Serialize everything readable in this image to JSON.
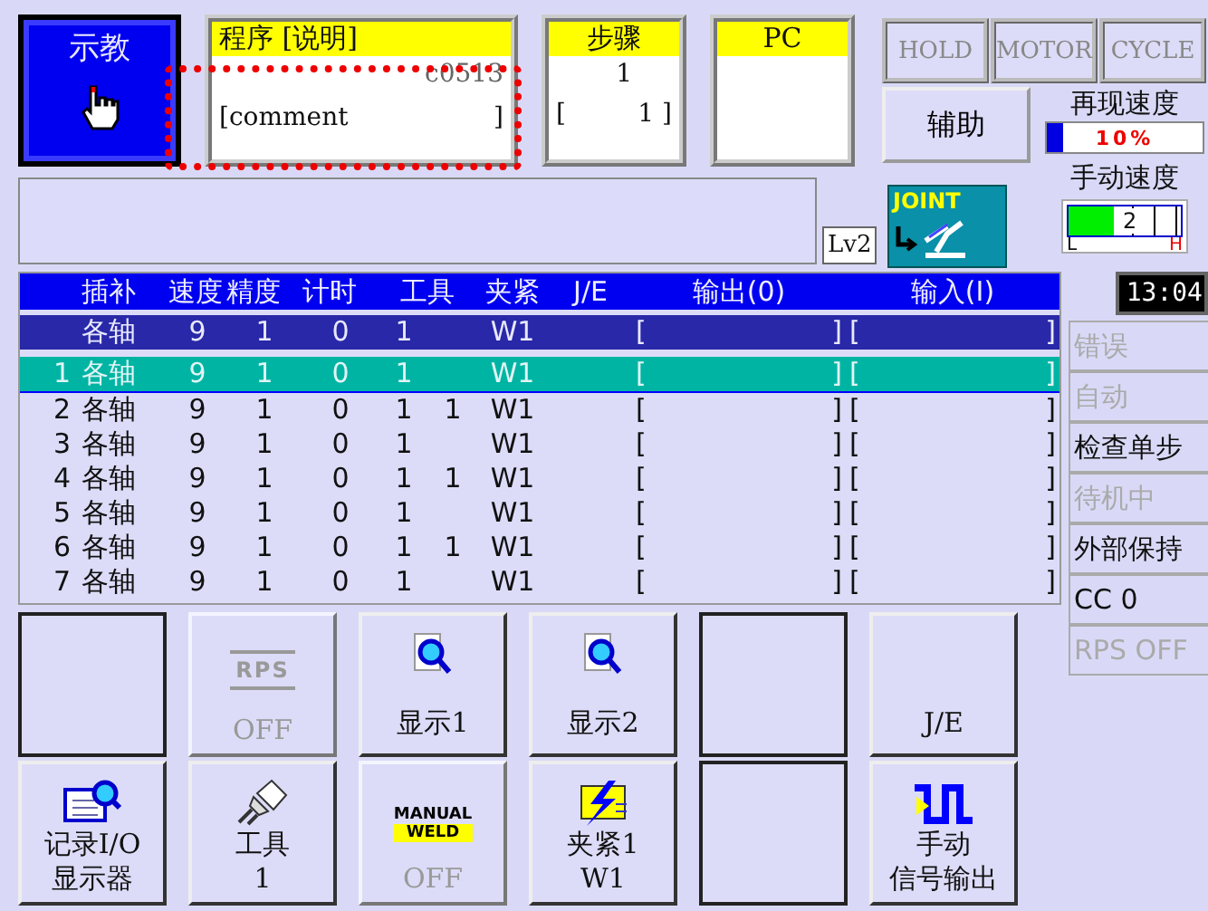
{
  "mode": {
    "label": "示教"
  },
  "program": {
    "header": "程序 [说明]",
    "name": "c0513",
    "comment": [
      "[comment",
      "]"
    ],
    "highlighted": true
  },
  "step": {
    "header": "步骤",
    "value": "1",
    "sub": [
      "[",
      "1 ]"
    ]
  },
  "pc": {
    "header": "PC"
  },
  "status_buttons": [
    {
      "label": "HOLD",
      "disabled": true
    },
    {
      "label": "MOTOR",
      "disabled": true
    },
    {
      "label": "CYCLE",
      "disabled": true
    }
  ],
  "aux_button": {
    "label": "辅助"
  },
  "play_speed": {
    "label": "再现速度",
    "reading": "10%",
    "level": 0.1
  },
  "manual_speed": {
    "label": "手动速度",
    "reading": "2",
    "low": "L",
    "high": "H",
    "level": 0.4
  },
  "level_badge": "Lv2",
  "coord": {
    "label": "JOINT"
  },
  "time": "13:04",
  "table": {
    "columns": [
      "插补",
      "速度",
      "精度",
      "计时",
      "工具",
      "夹紧",
      "J/E",
      "输出(0)",
      "输入(I)"
    ],
    "current_row": {
      "interp": "各轴",
      "speed": "9",
      "precision": "1",
      "timer": "0",
      "tool": "1",
      "clamp": "W1",
      "output": [
        "[",
        "]"
      ],
      "input": [
        "[",
        "]"
      ]
    },
    "rows": [
      {
        "no": "1",
        "interp": "各轴",
        "speed": "9",
        "precision": "1",
        "timer": "0",
        "tool": "1",
        "clamp": "W1",
        "output": [
          "[",
          "]"
        ],
        "input": [
          "[",
          "]"
        ],
        "selected": true
      },
      {
        "no": "2",
        "interp": "各轴",
        "speed": "9",
        "precision": "1",
        "timer": "0",
        "tool": "1",
        "tool2": "1",
        "clamp": "W1",
        "output": [
          "[",
          "]"
        ],
        "input": [
          "[",
          "]"
        ],
        "selected": false
      },
      {
        "no": "3",
        "interp": "各轴",
        "speed": "9",
        "precision": "1",
        "timer": "0",
        "tool": "1",
        "clamp": "W1",
        "output": [
          "[",
          "]"
        ],
        "input": [
          "[",
          "]"
        ],
        "selected": false
      },
      {
        "no": "4",
        "interp": "各轴",
        "speed": "9",
        "precision": "1",
        "timer": "0",
        "tool": "1",
        "tool2": "1",
        "clamp": "W1",
        "output": [
          "[",
          "]"
        ],
        "input": [
          "[",
          "]"
        ],
        "selected": false
      },
      {
        "no": "5",
        "interp": "各轴",
        "speed": "9",
        "precision": "1",
        "timer": "0",
        "tool": "1",
        "clamp": "W1",
        "output": [
          "[",
          "]"
        ],
        "input": [
          "[",
          "]"
        ],
        "selected": false
      },
      {
        "no": "6",
        "interp": "各轴",
        "speed": "9",
        "precision": "1",
        "timer": "0",
        "tool": "1",
        "tool2": "1",
        "clamp": "W1",
        "output": [
          "[",
          "]"
        ],
        "input": [
          "[",
          "]"
        ],
        "selected": false
      },
      {
        "no": "7",
        "interp": "各轴",
        "speed": "9",
        "precision": "1",
        "timer": "0",
        "tool": "1",
        "clamp": "W1",
        "output": [
          "[",
          "]"
        ],
        "input": [
          "[",
          "]"
        ],
        "selected": false
      }
    ]
  },
  "status_list": [
    {
      "label": "错误",
      "disabled": true
    },
    {
      "label": "自动",
      "disabled": true
    },
    {
      "label": "检查单步",
      "disabled": false
    },
    {
      "label": "待机中",
      "disabled": true
    },
    {
      "label": "外部保持",
      "disabled": false
    },
    {
      "label": "CC 0",
      "disabled": false
    },
    {
      "label": "RPS OFF",
      "disabled": true
    }
  ],
  "function_buttons": [
    {
      "kind": "blank",
      "disabled": false
    },
    {
      "kind": "rps",
      "icon_text": [
        "RPS"
      ],
      "lines": [
        "OFF"
      ],
      "disabled": true
    },
    {
      "kind": "display",
      "lines": [
        "显示1"
      ],
      "disabled": false
    },
    {
      "kind": "display",
      "lines": [
        "显示2"
      ],
      "disabled": false
    },
    {
      "kind": "blank",
      "disabled": false
    },
    {
      "kind": "plain",
      "lines": [
        "J/E"
      ],
      "disabled": false
    },
    {
      "kind": "record",
      "lines": [
        "记录I/O",
        "显示器"
      ],
      "disabled": false
    },
    {
      "kind": "tool",
      "lines": [
        "工具",
        "1"
      ],
      "disabled": false
    },
    {
      "kind": "weld",
      "icon_text": [
        "MANUAL",
        "WELD"
      ],
      "lines": [
        "OFF"
      ],
      "disabled": true
    },
    {
      "kind": "clamp",
      "lines": [
        "夹紧1",
        "W1"
      ],
      "disabled": false
    },
    {
      "kind": "blank",
      "disabled": false
    },
    {
      "kind": "signal",
      "lines": [
        "手动",
        "信号输出"
      ],
      "disabled": false
    }
  ]
}
